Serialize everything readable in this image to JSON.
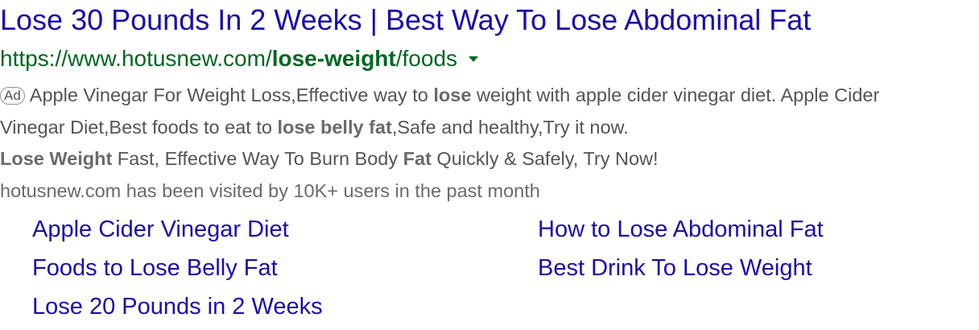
{
  "ad": {
    "title": "Lose 30 Pounds In 2 Weeks | Best Way To Lose Abdominal Fat",
    "url": {
      "prefix": "https://www.hotusnew.com/",
      "bold_part": "lose-weight",
      "suffix": "/foods",
      "dropdown_icon": "caret-down-icon"
    },
    "badge": "Ad",
    "description": {
      "line1": {
        "part1": "Apple Vinegar For Weight Loss,Effective way to ",
        "bold1": "lose",
        "part2": " weight with apple cider vinegar diet. Apple Cider"
      },
      "line2": {
        "part1": "Vinegar Diet,Best foods to eat to ",
        "bold1": "lose belly fat",
        "part2": ",Safe and healthy,Try it now."
      },
      "line3": {
        "bold1": "Lose Weight",
        "part1": " Fast, Effective Way To Burn Body ",
        "bold2": "Fat",
        "part2": " Quickly & Safely, Try Now!"
      }
    },
    "visits": "hotusnew.com has been visited by 10K+ users in the past month",
    "sitelinks": [
      "Apple Cider Vinegar Diet",
      "How to Lose Abdominal Fat",
      "Foods to Lose Belly Fat",
      "Best Drink To Lose Weight",
      "Lose 20 Pounds in 2 Weeks"
    ],
    "colors": {
      "title": "#1a0dab",
      "url": "#006621",
      "text": "#545454"
    }
  }
}
